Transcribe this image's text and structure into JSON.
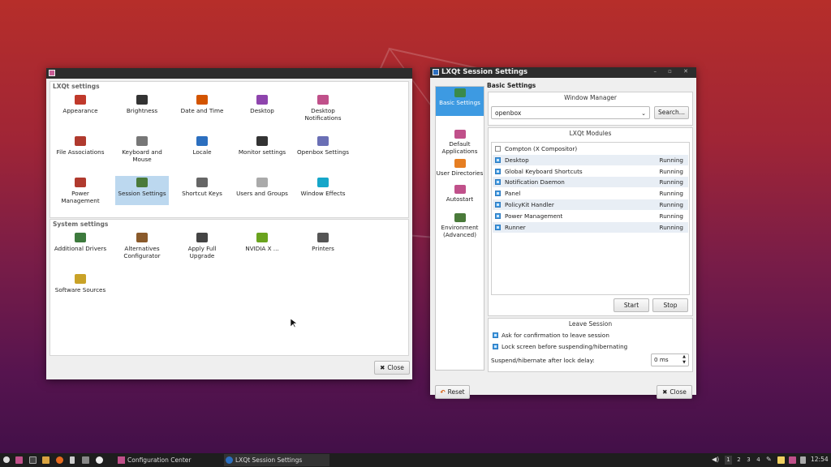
{
  "colors": {
    "accent": "#3d9ae2",
    "selection": "#bcd8ef",
    "titlebar": "#2d2d2d",
    "taskbar": "#1e1e1e"
  },
  "config_center": {
    "lxqt_settings_title": "LXQt settings",
    "lxqt_items": [
      {
        "label": "Appearance",
        "icon": "appearance-icon",
        "color": "#c0392b"
      },
      {
        "label": "Brightness",
        "icon": "brightness-icon",
        "color": "#333333"
      },
      {
        "label": "Date and Time",
        "icon": "date-time-icon",
        "color": "#d35400"
      },
      {
        "label": "Desktop",
        "icon": "desktop-icon",
        "color": "#8e44ad"
      },
      {
        "label": "Desktop Notifications",
        "icon": "notifications-icon",
        "color": "#c0508a"
      },
      {
        "label": "File Associations",
        "icon": "file-associations-icon",
        "color": "#b03a2e"
      },
      {
        "label": "Keyboard and Mouse",
        "icon": "keyboard-mouse-icon",
        "color": "#777777"
      },
      {
        "label": "Locale",
        "icon": "locale-icon",
        "color": "#2c6fbf"
      },
      {
        "label": "Monitor settings",
        "icon": "monitor-icon",
        "color": "#333333"
      },
      {
        "label": "Openbox Settings",
        "icon": "openbox-icon",
        "color": "#6a6fb5"
      },
      {
        "label": "Power Management",
        "icon": "power-icon",
        "color": "#b03a2e"
      },
      {
        "label": "Session Settings",
        "icon": "session-icon",
        "color": "#4a7a3a"
      },
      {
        "label": "Shortcut Keys",
        "icon": "shortcut-keys-icon",
        "color": "#666666"
      },
      {
        "label": "Users and Groups",
        "icon": "users-icon",
        "color": "#aaaaaa"
      },
      {
        "label": "Window Effects",
        "icon": "window-effects-icon",
        "color": "#16a6c9"
      }
    ],
    "system_settings_title": "System settings",
    "system_items": [
      {
        "label": "Additional Drivers",
        "icon": "drivers-icon",
        "color": "#3d7a3d"
      },
      {
        "label": "Alternatives Configurator",
        "icon": "alternatives-icon",
        "color": "#8a5a2b"
      },
      {
        "label": "Apply Full Upgrade",
        "icon": "upgrade-icon",
        "color": "#444444"
      },
      {
        "label": "NVIDIA X ...",
        "icon": "nvidia-icon",
        "color": "#6aa31e"
      },
      {
        "label": "Printers",
        "icon": "printer-icon",
        "color": "#555555"
      },
      {
        "label": "Software Sources",
        "icon": "software-sources-icon",
        "color": "#c9a227"
      }
    ],
    "close_label": "Close"
  },
  "session": {
    "title": "LXQt Session Settings",
    "sidebar": [
      {
        "label": "Basic Settings",
        "icon": "basic-settings-icon",
        "color": "#3a8a4a"
      },
      {
        "label": "Default Applications",
        "icon": "default-apps-icon",
        "color": "#c0508a"
      },
      {
        "label": "User Directories",
        "icon": "user-dirs-icon",
        "color": "#e67e22"
      },
      {
        "label": "Autostart",
        "icon": "autostart-icon",
        "color": "#c0508a"
      },
      {
        "label": "Environment (Advanced)",
        "icon": "environment-icon",
        "color": "#4a7a3a"
      }
    ],
    "heading": "Basic Settings",
    "wm_title": "Window Manager",
    "wm_value": "openbox",
    "search_label": "Search...",
    "modules_title": "LXQt Modules",
    "modules": [
      {
        "name": "Compton (X Compositor)",
        "status": "",
        "checked": false
      },
      {
        "name": "Desktop",
        "status": "Running",
        "checked": true
      },
      {
        "name": "Global Keyboard Shortcuts",
        "status": "Running",
        "checked": true
      },
      {
        "name": "Notification Daemon",
        "status": "Running",
        "checked": true
      },
      {
        "name": "Panel",
        "status": "Running",
        "checked": true
      },
      {
        "name": "PolicyKit Handler",
        "status": "Running",
        "checked": true
      },
      {
        "name": "Power Management",
        "status": "Running",
        "checked": true
      },
      {
        "name": "Runner",
        "status": "Running",
        "checked": true
      }
    ],
    "start_label": "Start",
    "stop_label": "Stop",
    "leave_title": "Leave Session",
    "ask_confirm": "Ask for confirmation to leave session",
    "lock_screen": "Lock screen before suspending/hibernating",
    "delay_label": "Suspend/hibernate after lock delay:",
    "delay_value": "0 ms",
    "reset_label": "Reset",
    "close_label": "Close"
  },
  "taskbar": {
    "tasks": [
      "Configuration Center",
      "LXQt Session Settings"
    ],
    "workspaces": [
      "1",
      "2",
      "3",
      "4"
    ],
    "clock": "12:54"
  }
}
